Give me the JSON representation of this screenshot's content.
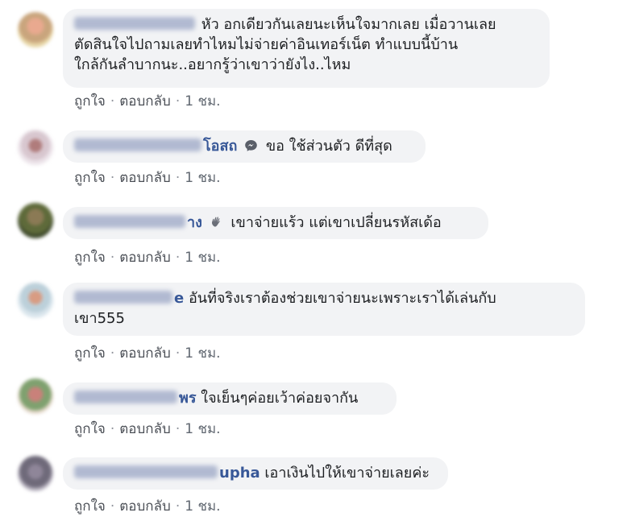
{
  "action_labels": {
    "like": "ถูกใจ",
    "reply": "ตอบกลับ",
    "separator": "·",
    "time": "1 ชม."
  },
  "comments": [
    {
      "name_visible": "",
      "text_lines": [
        "หัว อกเดียวกันเลยนะเห็นใจมากเลย เมื่อวานเลย",
        "ตัดสินใจไปถามเลยทำไหมไม่จ่ายค่าอินเทอร์เน็ต ทำแบบนี้บ้าน",
        "ใกล้กันลำบากนะ..อยากรู้ว่าเขาว่ายังไง..ไหม"
      ]
    },
    {
      "name_visible": "โอสถ",
      "badge_icon": "messenger-icon",
      "text_lines": [
        "ขอ ใช้ส่วนตัว ดีที่สุด"
      ]
    },
    {
      "name_visible": "าง",
      "badge_icon": "waving-hand-icon",
      "text_lines": [
        "เขาจ่ายแร้ว แต่เขาเปลี่ยนรหัสเด้อ"
      ]
    },
    {
      "name_visible": "e",
      "text_lines": [
        "อันที่จริงเราต้องช่วยเขาจ่ายนะเพราะเราได้เล่นกับ",
        "เขา555"
      ]
    },
    {
      "name_visible": "พร",
      "text_lines": [
        "ใจเย็นๆค่อยเว้าค่อยจากัน"
      ]
    },
    {
      "name_visible": "upha",
      "text_lines": [
        "เอาเงินไปให้เขาจ่ายเลยค่ะ"
      ]
    }
  ],
  "colors": {
    "bubble": "#f2f3f5",
    "name": "#385898",
    "meta": "#606770"
  }
}
